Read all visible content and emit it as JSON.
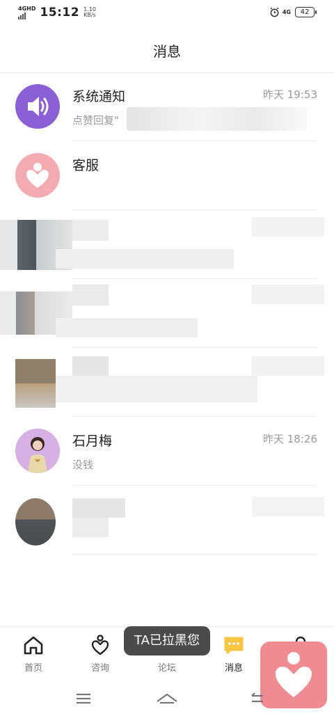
{
  "status": {
    "network": "4GHD",
    "time": "15:12",
    "speed_value": "1.10",
    "speed_unit": "KB/s",
    "network_right": "4G",
    "battery": "42"
  },
  "header": {
    "title": "消息"
  },
  "messages": [
    {
      "name": "系统通知",
      "time": "昨天 19:53",
      "preview": "点赞回复\""
    },
    {
      "name": "客服",
      "time": "",
      "preview": ""
    },
    {
      "name": "",
      "time": "",
      "preview": ""
    },
    {
      "name": "",
      "time": "",
      "preview": ""
    },
    {
      "name": "",
      "time": "",
      "preview": ""
    },
    {
      "name": "石月梅",
      "time": "昨天 18:26",
      "preview": "没钱"
    },
    {
      "name": "",
      "time": "",
      "preview": ""
    }
  ],
  "tabs": [
    {
      "label": "首页",
      "icon": "home-icon"
    },
    {
      "label": "咨询",
      "icon": "heart-person-icon"
    },
    {
      "label": "论坛",
      "icon": "forum-icon"
    },
    {
      "label": "消息",
      "icon": "message-icon"
    },
    {
      "label": "",
      "icon": "profile-icon"
    }
  ],
  "toast": {
    "text": "TA已拉黑您"
  },
  "colors": {
    "accent_yellow": "#f7c541",
    "notice_purple": "#8b5fd6",
    "service_pink": "#f3aab1",
    "float_pink": "#f08c91"
  }
}
